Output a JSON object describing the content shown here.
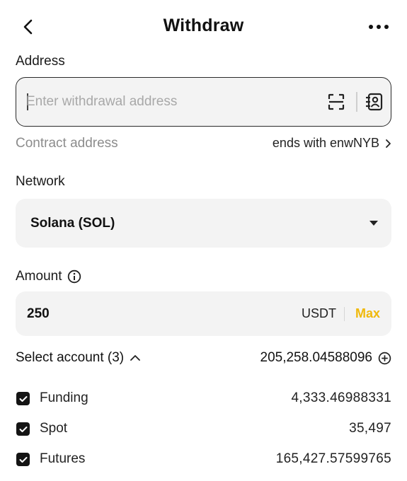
{
  "header": {
    "title": "Withdraw"
  },
  "address": {
    "label": "Address",
    "placeholder": "Enter withdrawal address",
    "value": ""
  },
  "contract": {
    "label": "Contract address",
    "value": "ends with enwNYB"
  },
  "network": {
    "label": "Network",
    "selected": "Solana (SOL)"
  },
  "amount": {
    "label": "Amount",
    "value": "250",
    "currency": "USDT",
    "max_label": "Max"
  },
  "accounts": {
    "select_label": "Select account (3)",
    "total": "205,258.04588096",
    "items": [
      {
        "name": "Funding",
        "value": "4,333.46988331",
        "checked": true
      },
      {
        "name": "Spot",
        "value": "35,497",
        "checked": true
      },
      {
        "name": "Futures",
        "value": "165,427.57599765",
        "checked": true
      }
    ]
  },
  "colors": {
    "accent": "#f0b90b",
    "field_bg": "#f3f3f3",
    "muted_text": "#8c8c8c"
  }
}
